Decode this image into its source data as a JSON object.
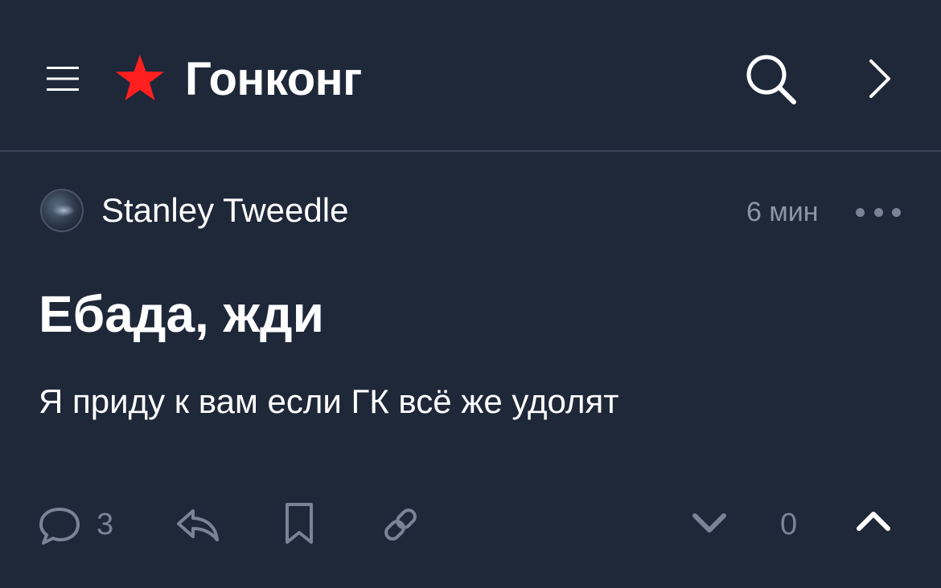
{
  "header": {
    "title": "Гонконг",
    "menu_icon": "hamburger-menu-icon",
    "community_icon": "red-star-icon",
    "search_icon": "search-icon",
    "forward_icon": "chevron-right-icon"
  },
  "post": {
    "author": "Stanley Tweedle",
    "time": "6 мин",
    "title": "Ебада, жди",
    "body": "Я приду к вам если ГК всё же удолят",
    "comments_count": "3",
    "score": "0"
  },
  "colors": {
    "background": "#1f2839",
    "star": "#ff1f1f",
    "muted": "#7a8496"
  }
}
